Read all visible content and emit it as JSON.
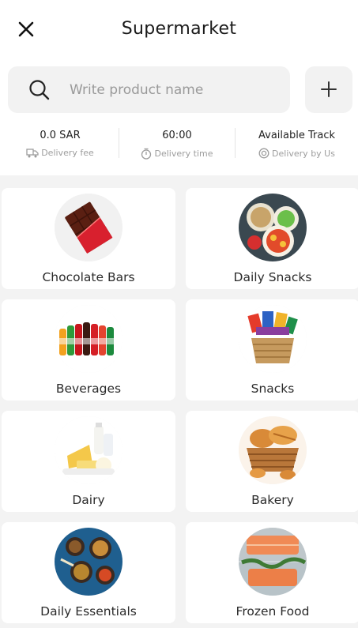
{
  "header": {
    "title": "Supermarket",
    "close_icon": "close-icon"
  },
  "search": {
    "placeholder": "Write product name",
    "value": "",
    "icon": "search-icon",
    "add_icon": "plus-icon"
  },
  "info": [
    {
      "value": "0.0 SAR",
      "label": "Delivery fee",
      "icon": "delivery-truck-icon"
    },
    {
      "value": "60:00",
      "label": "Delivery time",
      "icon": "stopwatch-icon"
    },
    {
      "value": "Available Track",
      "label": "Delivery by Us",
      "icon": "tracking-icon"
    }
  ],
  "categories": [
    {
      "label": "Chocolate Bars",
      "image": "chocolate-bar-image"
    },
    {
      "label": "Daily Snacks",
      "image": "snack-bowls-image"
    },
    {
      "label": "Beverages",
      "image": "soda-bottles-image"
    },
    {
      "label": "Snacks",
      "image": "snack-basket-image"
    },
    {
      "label": "Dairy",
      "image": "dairy-products-image"
    },
    {
      "label": "Bakery",
      "image": "bread-basket-image"
    },
    {
      "label": "Daily Essentials",
      "image": "spices-image"
    },
    {
      "label": "Frozen Food",
      "image": "frozen-salmon-image"
    }
  ],
  "colors": {
    "background": "#f3f3f3",
    "card": "#ffffff",
    "muted_text": "#9d9d9d"
  }
}
